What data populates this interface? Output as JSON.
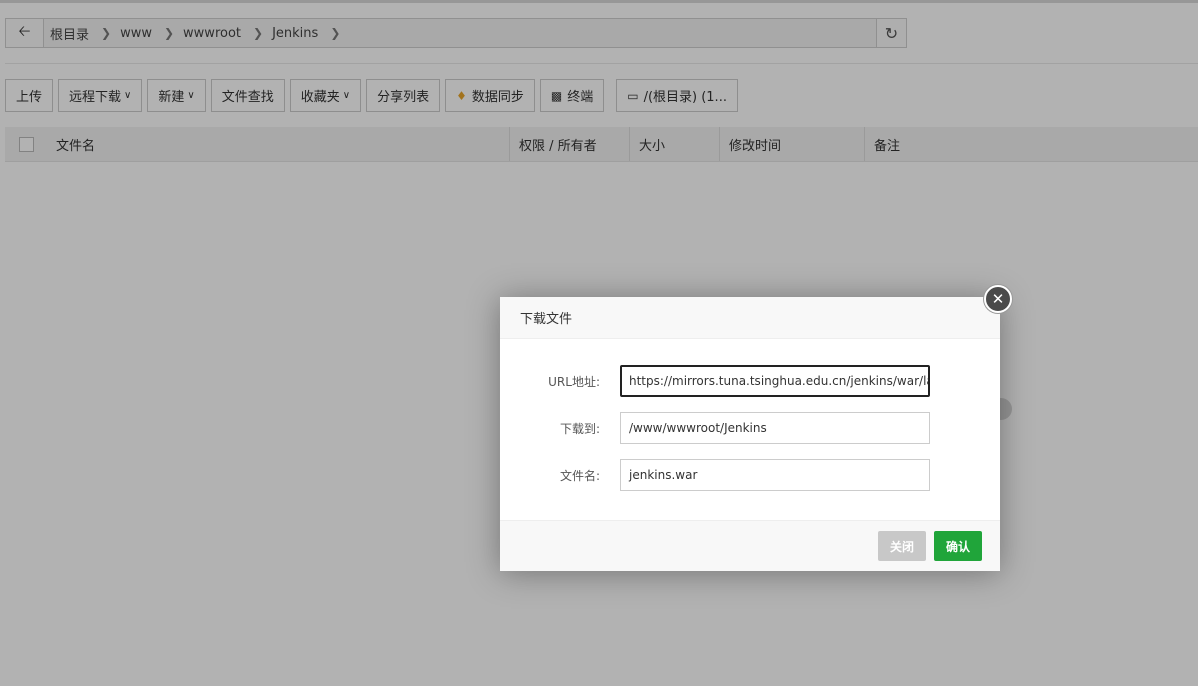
{
  "breadcrumb": {
    "items": [
      "根目录",
      "www",
      "wwwroot",
      "Jenkins"
    ]
  },
  "toolbar": {
    "upload": "上传",
    "remote_download": "远程下载",
    "new": "新建",
    "file_search": "文件查找",
    "favorites": "收藏夹",
    "share_list": "分享列表",
    "data_sync": "数据同步",
    "terminal": "终端",
    "disk": "/(根目录) (1..."
  },
  "table": {
    "columns": [
      "文件名",
      "权限 / 所有者",
      "大小",
      "修改时间",
      "备注"
    ]
  },
  "dialog": {
    "title": "下载文件",
    "url_label": "URL地址:",
    "url_value": "https://mirrors.tuna.tsinghua.edu.cn/jenkins/war/lat",
    "dest_label": "下载到:",
    "dest_value": "/www/wwwroot/Jenkins",
    "filename_label": "文件名:",
    "filename_value": "jenkins.war",
    "close_label": "关闭",
    "confirm_label": "确认"
  },
  "colors": {
    "confirm_green": "#20a53a",
    "data_sync_icon": "#e8a52a"
  }
}
